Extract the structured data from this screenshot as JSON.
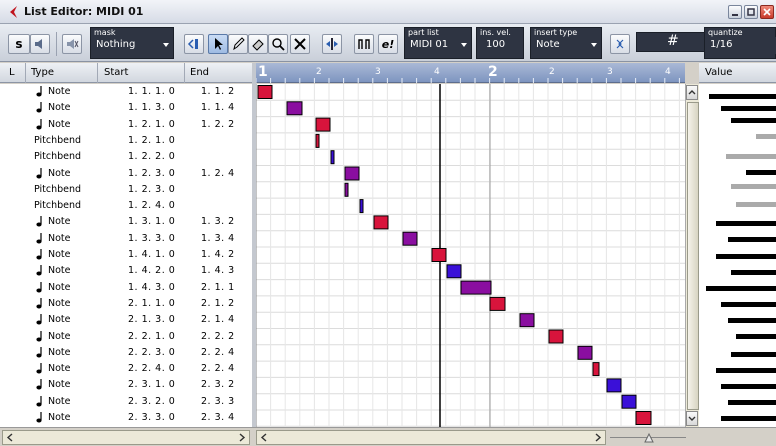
{
  "window": {
    "title": "List Editor: MIDI 01"
  },
  "toolbar": {
    "mask_label": "mask",
    "mask_value": "Nothing",
    "part_list_label": "part list",
    "part_list_value": "MIDI 01",
    "ins_vel_label": "ins. vel.",
    "ins_vel_value": "100",
    "insert_type_label": "insert type",
    "insert_type_value": "Note",
    "quantize_label": "quantize",
    "quantize_value": "1/16",
    "s_button_label": "s",
    "e_button_label": "e!"
  },
  "list": {
    "headers": {
      "l": "L",
      "type": "Type",
      "start": "Start",
      "end": "End"
    },
    "rows": [
      {
        "type": "Note",
        "start": "1. 1. 1.   0",
        "end": "1. 1. 2",
        "icon": "note-icon"
      },
      {
        "type": "Note",
        "start": "1. 1. 3.   0",
        "end": "1. 1. 4",
        "icon": "note-icon"
      },
      {
        "type": "Note",
        "start": "1. 2. 1.   0",
        "end": "1. 2. 2",
        "icon": "note-icon"
      },
      {
        "type": "Pitchbend",
        "start": "1. 2. 1.   0",
        "end": "",
        "icon": ""
      },
      {
        "type": "Pitchbend",
        "start": "1. 2. 2.   0",
        "end": "",
        "icon": ""
      },
      {
        "type": "Note",
        "start": "1. 2. 3.   0",
        "end": "1. 2. 4",
        "icon": "note-icon"
      },
      {
        "type": "Pitchbend",
        "start": "1. 2. 3.   0",
        "end": "",
        "icon": ""
      },
      {
        "type": "Pitchbend",
        "start": "1. 2. 4.   0",
        "end": "",
        "icon": ""
      },
      {
        "type": "Note",
        "start": "1. 3. 1.   0",
        "end": "1. 3. 2",
        "icon": "note-icon"
      },
      {
        "type": "Note",
        "start": "1. 3. 3.   0",
        "end": "1. 3. 4",
        "icon": "note-icon"
      },
      {
        "type": "Note",
        "start": "1. 4. 1.   0",
        "end": "1. 4. 2",
        "icon": "note-icon"
      },
      {
        "type": "Note",
        "start": "1. 4. 2.   0",
        "end": "1. 4. 3",
        "icon": "note-icon"
      },
      {
        "type": "Note",
        "start": "1. 4. 3.   0",
        "end": "2. 1. 1",
        "icon": "note-icon"
      },
      {
        "type": "Note",
        "start": "2. 1. 1.   0",
        "end": "2. 1. 2",
        "icon": "note-icon"
      },
      {
        "type": "Note",
        "start": "2. 1. 3.   0",
        "end": "2. 1. 4",
        "icon": "note-icon"
      },
      {
        "type": "Note",
        "start": "2. 2. 1.   0",
        "end": "2. 2. 2",
        "icon": "note-icon"
      },
      {
        "type": "Note",
        "start": "2. 2. 3.   0",
        "end": "2. 2. 4",
        "icon": "note-icon"
      },
      {
        "type": "Note",
        "start": "2. 2. 4.   0",
        "end": "2. 2. 4",
        "icon": "note-icon"
      },
      {
        "type": "Note",
        "start": "2. 3. 1.   0",
        "end": "2. 3. 2",
        "icon": "note-icon"
      },
      {
        "type": "Note",
        "start": "2. 3. 2.   0",
        "end": "2. 3. 3",
        "icon": "note-icon"
      },
      {
        "type": "Note",
        "start": "2. 3. 3.   0",
        "end": "2. 3. 4",
        "icon": "note-icon"
      }
    ]
  },
  "ruler": {
    "labels": [
      "1",
      "2",
      "3",
      "4",
      "2",
      "2",
      "3",
      "4"
    ]
  },
  "value_header": "Value",
  "colors": {
    "note_red": "#d8143c",
    "note_purple": "#8a0ea0",
    "note_blue": "#3a10d8",
    "toolbar_field": "#2e3442",
    "ruler": "#8ea2c9"
  }
}
